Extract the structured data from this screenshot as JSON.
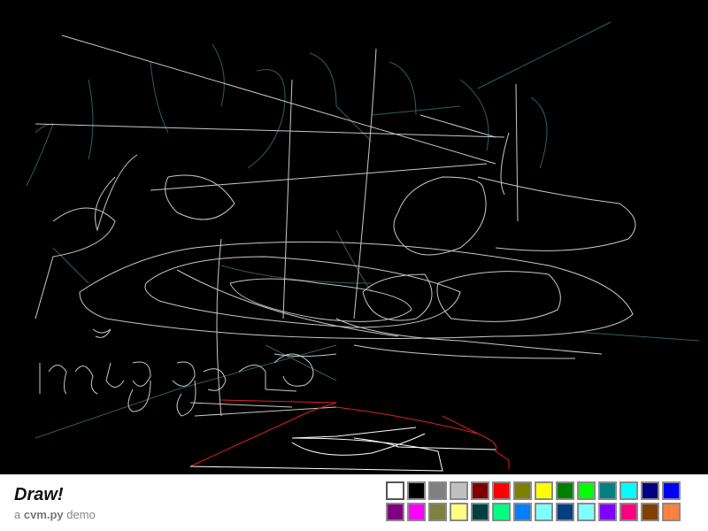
{
  "app": {
    "title": "Draw!",
    "subtitle_prefix": "a",
    "subtitle_lib": "cvm.py",
    "subtitle_suffix": "demo"
  },
  "palette": {
    "colors": [
      "#ffffff",
      "#000000",
      "#808080",
      "#c0c0c0",
      "#800000",
      "#ff0000",
      "#808000",
      "#ffff00",
      "#008000",
      "#00ff00",
      "#008080",
      "#00ffff",
      "#000080",
      "#0000ff",
      "#800080",
      "#ff00ff",
      "#808040",
      "#ffff80",
      "#004040",
      "#00ff80",
      "#0080ff",
      "#80ffff",
      "#004080",
      "#80ffff",
      "#8000ff",
      "#ff0080",
      "#804000",
      "#ff8040"
    ],
    "selected_index": 0
  },
  "canvas": {
    "stroke_colors": [
      "#c8c8c8",
      "#2a5a5a",
      "#e02020",
      "#ffffff"
    ]
  }
}
